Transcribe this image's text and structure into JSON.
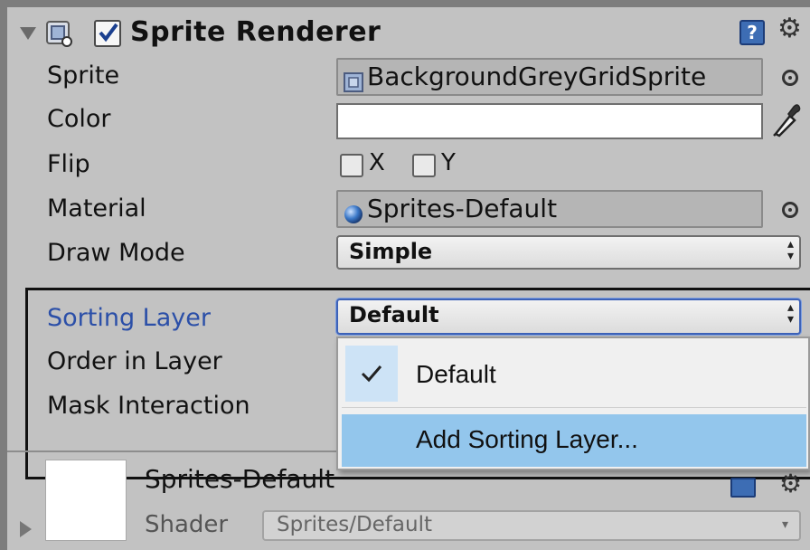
{
  "component": {
    "title": "Sprite Renderer",
    "enabled": true,
    "icons": [
      "fold-arrow-icon",
      "sprite-renderer-icon",
      "help-icon",
      "gear-icon"
    ]
  },
  "fields": {
    "sprite": {
      "label": "Sprite",
      "value": "BackgroundGreyGridSprite"
    },
    "color": {
      "label": "Color",
      "value": "#ffffff"
    },
    "flip": {
      "label": "Flip",
      "x_label": "X",
      "y_label": "Y",
      "x_checked": false,
      "y_checked": false
    },
    "material": {
      "label": "Material",
      "value": "Sprites-Default"
    },
    "draw_mode": {
      "label": "Draw Mode",
      "value": "Simple"
    },
    "sorting_layer": {
      "label": "Sorting Layer",
      "value": "Default"
    },
    "order_in_layer": {
      "label": "Order in Layer"
    },
    "mask_interaction": {
      "label": "Mask Interaction"
    }
  },
  "sorting_layer_menu": {
    "items": [
      {
        "label": "Default",
        "checked": true
      },
      {
        "label": "Add Sorting Layer...",
        "checked": false,
        "highlighted": true
      }
    ]
  },
  "material_section": {
    "name": "Sprites-Default",
    "shader_label": "Shader",
    "shader_value": "Sprites/Default"
  },
  "colors": {
    "panel_bg": "#c2c2c2",
    "label_selected": "#2b4fa8",
    "menu_highlight": "#93c6ec",
    "menu_check_bg": "#cde3f6"
  }
}
